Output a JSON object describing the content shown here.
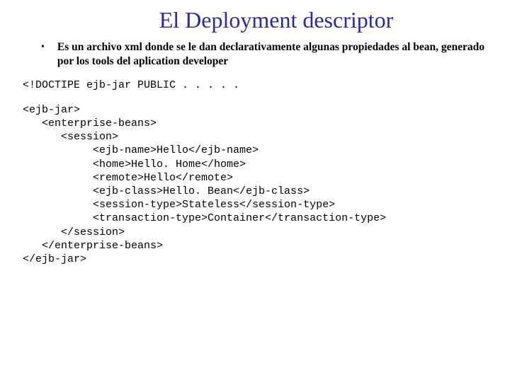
{
  "title": "El Deployment descriptor",
  "bullet": {
    "marker": "•",
    "text": "Es un archivo xml donde se le dan declarativamente algunas propiedades al bean, generado por los tools del aplication developer"
  },
  "code_doctype": "<!DOCTIPE ejb-jar PUBLIC . . . . .",
  "code_lines": [
    "<ejb-jar>",
    "   <enterprise-beans>",
    "      <session>",
    "           <ejb-name>Hello</ejb-name>",
    "           <home>Hello. Home</home>",
    "           <remote>Hello</remote>",
    "           <ejb-class>Hello. Bean</ejb-class>",
    "           <session-type>Stateless</session-type>",
    "           <transaction-type>Container</transaction-type>",
    "      </session>",
    "   </enterprise-beans>",
    "</ejb-jar>"
  ]
}
